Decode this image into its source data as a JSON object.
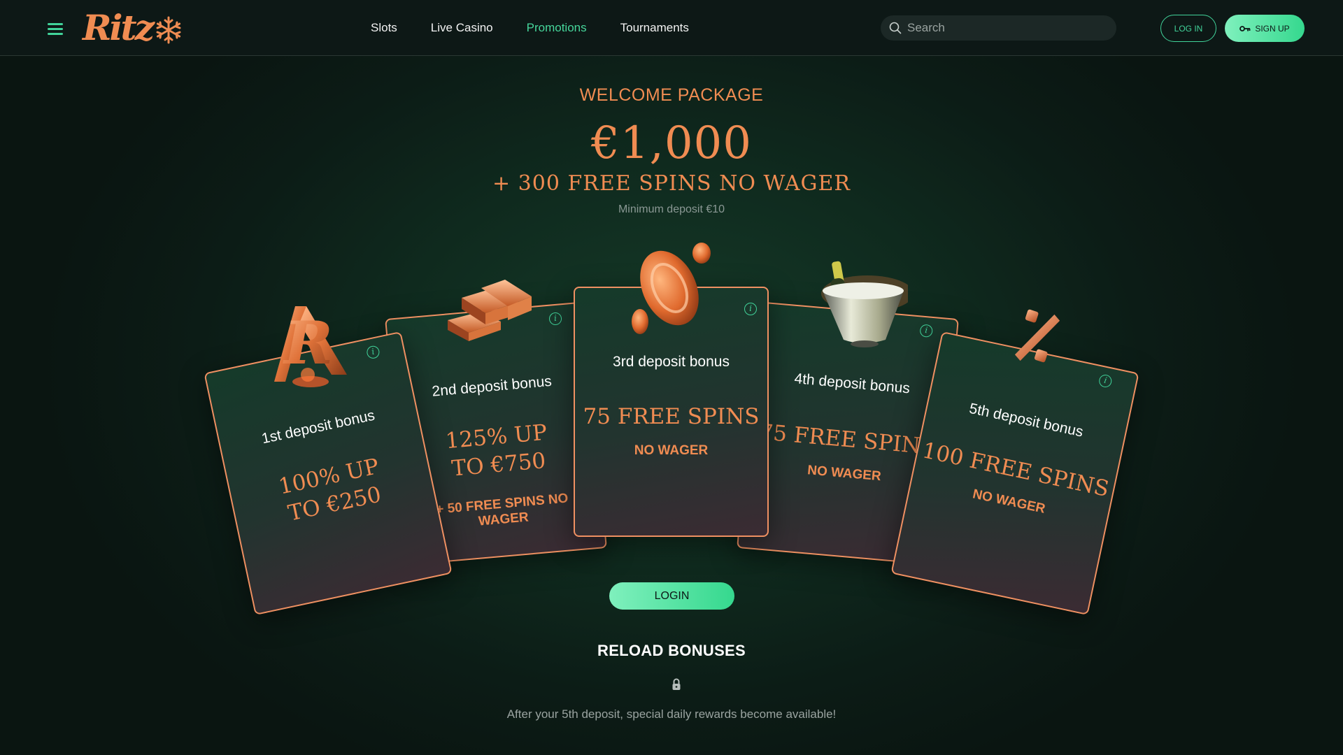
{
  "header": {
    "logo_text": "Ritz",
    "nav": [
      "Slots",
      "Live Casino",
      "Promotions",
      "Tournaments"
    ],
    "active_nav": "Promotions",
    "search_placeholder": "Search",
    "login_label": "LOG IN",
    "signup_label": "SIGN UP"
  },
  "hero": {
    "kicker": "WELCOME PACKAGE",
    "amount": "€1,000",
    "subtitle": "+ 300 FREE SPINS NO WAGER",
    "min_deposit": "Minimum deposit €10"
  },
  "cards": [
    {
      "title": "1st deposit bonus",
      "offer": "100% UP TO €250",
      "extra": "",
      "icon": "r-monogram-icon"
    },
    {
      "title": "2nd deposit bonus",
      "offer": "125% UP TO €750",
      "extra": "+ 50 FREE SPINS NO WAGER",
      "icon": "gold-bars-icon"
    },
    {
      "title": "3rd deposit bonus",
      "offer": "75 FREE SPINS",
      "extra": "NO WAGER",
      "icon": "coins-icon"
    },
    {
      "title": "4th deposit bonus",
      "offer": "75 FREE SPINS",
      "extra": "NO WAGER",
      "icon": "champagne-bucket-icon"
    },
    {
      "title": "5th deposit bonus",
      "offer": "100 FREE SPINS",
      "extra": "NO WAGER",
      "icon": "percent-icon"
    }
  ],
  "cta_label": "LOGIN",
  "reload": {
    "title": "RELOAD BONUSES",
    "description": "After your 5th deposit, special daily rewards become available!"
  },
  "colors": {
    "accent": "#41d39a",
    "orange": "#f08c52",
    "background": "#0f2a1e"
  }
}
